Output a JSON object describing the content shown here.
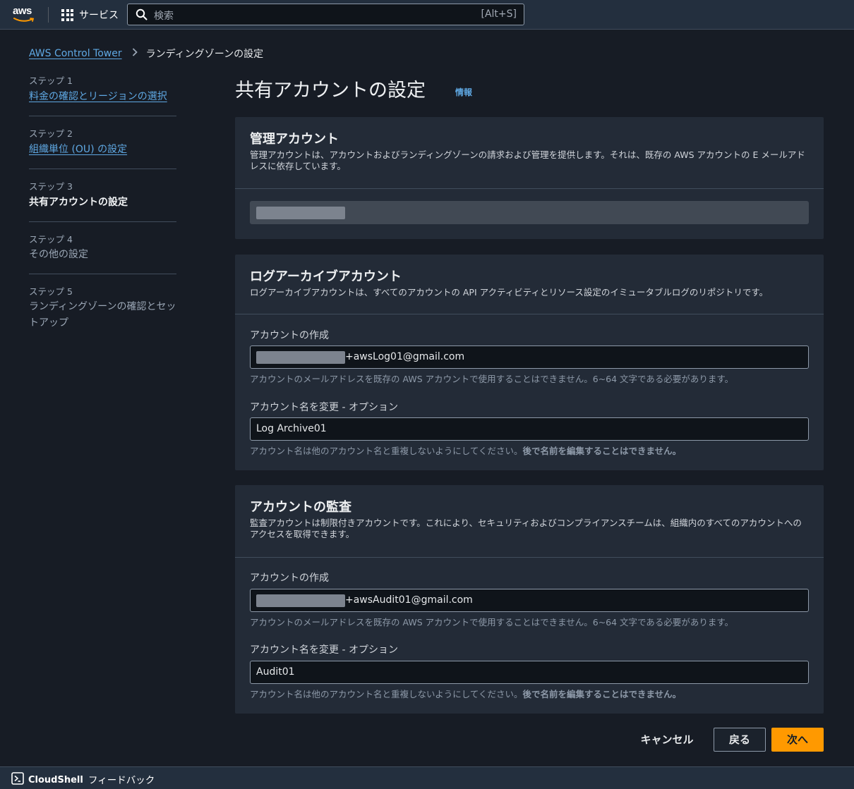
{
  "topnav": {
    "logo": "aws",
    "services_label": "サービス",
    "search_placeholder": "検索",
    "search_shortcut": "[Alt+S]"
  },
  "breadcrumb": {
    "root": "AWS Control Tower",
    "current": "ランディングゾーンの設定"
  },
  "steps": [
    {
      "num": "ステップ 1",
      "label": "料金の確認とリージョンの選択",
      "state": "link"
    },
    {
      "num": "ステップ 2",
      "label": "組織単位 (OU) の設定",
      "state": "link"
    },
    {
      "num": "ステップ 3",
      "label": "共有アカウントの設定",
      "state": "current"
    },
    {
      "num": "ステップ 4",
      "label": "その他の設定",
      "state": "disabled"
    },
    {
      "num": "ステップ 5",
      "label": "ランディングゾーンの確認とセットアップ",
      "state": "disabled"
    }
  ],
  "page": {
    "title": "共有アカウントの設定",
    "info": "情報"
  },
  "management": {
    "title": "管理アカウント",
    "description": "管理アカウントは、アカウントおよびランディングゾーンの請求および管理を提供します。それは、既存の AWS アカウントの E メールアドレスに依存しています。"
  },
  "log_archive": {
    "title": "ログアーカイブアカウント",
    "description": "ログアーカイブアカウントは、すべてのアカウントの API アクティビティとリソース設定のイミュータブルログのリポジトリです。",
    "create_label": "アカウントの作成",
    "email_suffix": "+awsLog01@gmail.com",
    "email_hint": "アカウントのメールアドレスを既存の AWS アカウントで使用することはできません。6~64 文字である必要があります。",
    "rename_label": "アカウント名を変更 - オプション",
    "name_value": "Log Archive01",
    "name_hint": "アカウント名は他のアカウント名と重複しないようにしてください。",
    "name_hint_bold": "後で名前を編集することはできません。"
  },
  "audit": {
    "title": "アカウントの監査",
    "description": "監査アカウントは制限付きアカウントです。これにより、セキュリティおよびコンプライアンスチームは、組織内のすべてのアカウントへのアクセスを取得できます。",
    "create_label": "アカウントの作成",
    "email_suffix": "+awsAudit01@gmail.com",
    "email_hint": "アカウントのメールアドレスを既存の AWS アカウントで使用することはできません。6~64 文字である必要があります。",
    "rename_label": "アカウント名を変更 - オプション",
    "name_value": "Audit01",
    "name_hint": "アカウント名は他のアカウント名と重複しないようにしてください。",
    "name_hint_bold": "後で名前を編集することはできません。"
  },
  "actions": {
    "cancel": "キャンセル",
    "back": "戻る",
    "next": "次へ"
  },
  "bottombar": {
    "cloudshell": "CloudShell",
    "feedback": "フィードバック"
  },
  "colors": {
    "accent": "#ff9900",
    "link": "#5fa8e3",
    "background": "#171c25",
    "container": "#232b37"
  }
}
